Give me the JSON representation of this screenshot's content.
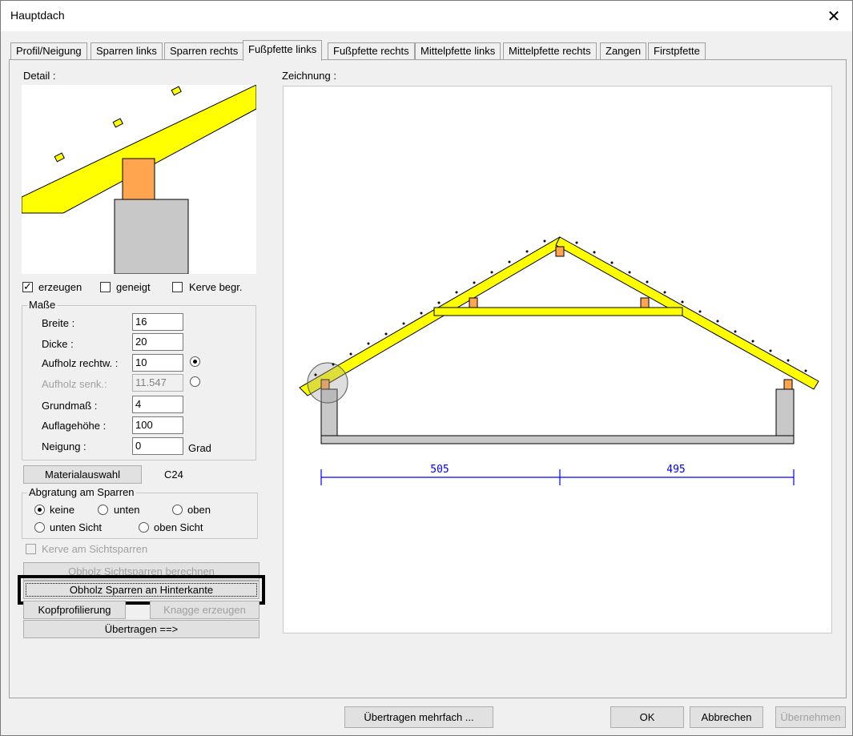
{
  "window": {
    "title": "Hauptdach",
    "close_glyph": "✕"
  },
  "tabs": [
    {
      "label": "Profil/Neigung"
    },
    {
      "label": "Sparren links"
    },
    {
      "label": "Sparren rechts"
    },
    {
      "label": "Fußpfette links"
    },
    {
      "label": "Fußpfette rechts"
    },
    {
      "label": "Mittelpfette links"
    },
    {
      "label": "Mittelpfette rechts"
    },
    {
      "label": "Zangen"
    },
    {
      "label": "Firstpfette"
    }
  ],
  "active_tab": "Fußpfette links",
  "detail": {
    "label": "Detail :"
  },
  "drawing": {
    "label": "Zeichnung :",
    "dim_left": "505",
    "dim_right": "495"
  },
  "options": {
    "erzeugen": {
      "label": "erzeugen",
      "checked": true
    },
    "geneigt": {
      "label": "geneigt",
      "checked": false
    },
    "kerve_begr": {
      "label": "Kerve begr.",
      "checked": false
    }
  },
  "masse": {
    "title": "Maße",
    "breite": {
      "label": "Breite :",
      "value": "16"
    },
    "dicke": {
      "label": "Dicke :",
      "value": "20"
    },
    "aufholz_rechtw": {
      "label": "Aufholz rechtw. :",
      "value": "10",
      "selected": true
    },
    "aufholz_senk": {
      "label": "Aufholz senk.:",
      "value": "11.547",
      "selected": false
    },
    "grundmass": {
      "label": "Grundmaß :",
      "value": "4"
    },
    "auflagehoehe": {
      "label": "Auflagehöhe :",
      "value": "100"
    },
    "neigung": {
      "label": "Neigung :",
      "value": "0",
      "unit": "Grad"
    }
  },
  "material": {
    "button": "Materialauswahl",
    "value": "C24"
  },
  "abgratung": {
    "title": "Abgratung am Sparren",
    "options": [
      "keine",
      "unten",
      "oben",
      "unten Sicht",
      "oben Sicht"
    ],
    "selected": "keine"
  },
  "kerve_sicht": {
    "label": "Kerve am Sichtsparren"
  },
  "buttons": {
    "obholz_sicht": "Obholz Sichtsparren berechnen",
    "obholz_hinter": "Obholz Sparren an Hinterkante",
    "kopfprofilierung": "Kopfprofilierung",
    "knagge": "Knagge erzeugen",
    "uebertragen": "Übertragen ==>"
  },
  "footer": {
    "uebertragen_mehrfach": "Übertragen mehrfach ...",
    "ok": "OK",
    "abbrechen": "Abbrechen",
    "uebernehmen": "Übernehmen"
  },
  "colors": {
    "rafter": "#ffff00",
    "purlin": "#ffa54f",
    "wall": "#c8c8c8",
    "dimension": "#0000ff"
  }
}
